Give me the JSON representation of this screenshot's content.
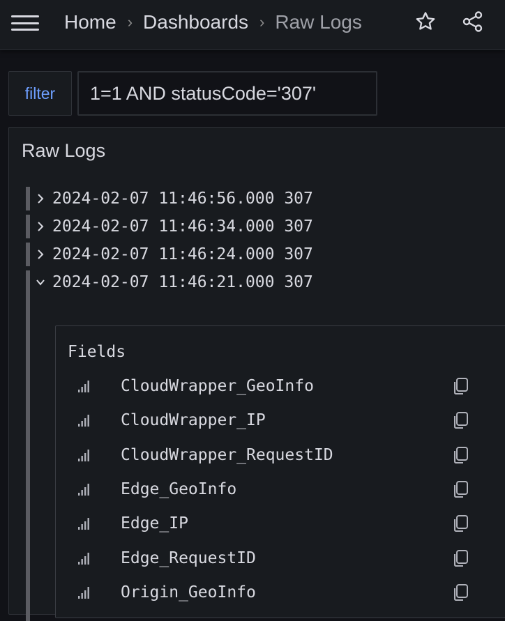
{
  "breadcrumb": {
    "items": [
      "Home",
      "Dashboards"
    ],
    "separator": "›",
    "current": "Raw Logs"
  },
  "filter": {
    "label": "filter",
    "value": "1=1 AND statusCode='307'"
  },
  "panel": {
    "title": "Raw Logs",
    "rows": [
      "2024-02-07 11:46:56.000 307",
      "2024-02-07 11:46:34.000 307",
      "2024-02-07 11:46:24.000 307",
      "2024-02-07 11:46:21.000 307"
    ],
    "details": {
      "title": "Fields",
      "fields": [
        "CloudWrapper_GeoInfo",
        "CloudWrapper_IP",
        "CloudWrapper_RequestID",
        "Edge_GeoInfo",
        "Edge_IP",
        "Edge_RequestID",
        "Origin_GeoInfo"
      ]
    }
  },
  "icons": {
    "menu": "hamburger-menu-icon",
    "star": "star-icon",
    "share": "share-icon",
    "chevron_right": "chevron-right-icon",
    "chevron_down": "chevron-down-icon",
    "stats": "signal-bars-icon",
    "copy": "copy-icon"
  },
  "colors": {
    "background": "#111217",
    "panel": "#181b1f",
    "accent": "#6e9fff",
    "text": "#d8d9e0"
  }
}
